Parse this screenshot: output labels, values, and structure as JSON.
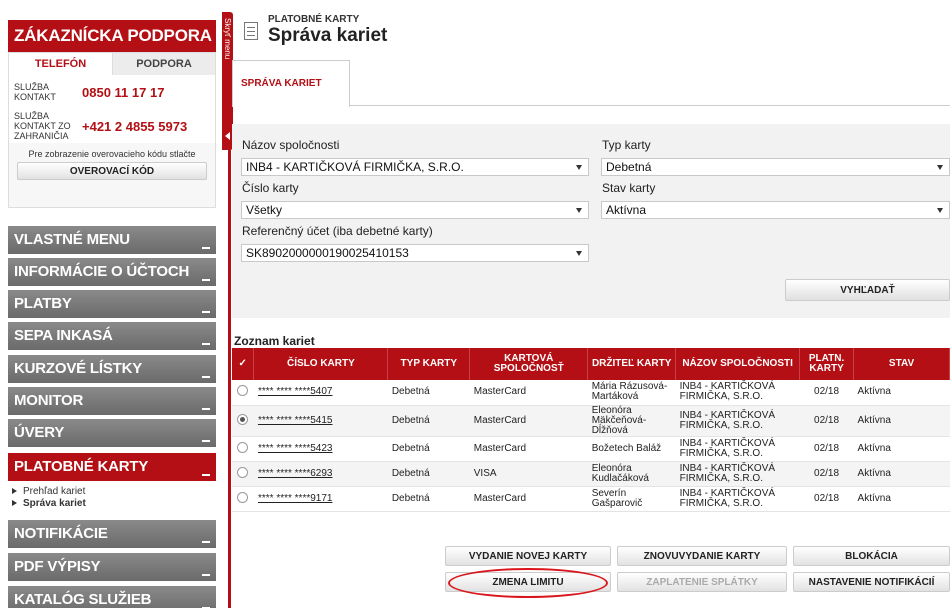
{
  "sidebar": {
    "support_title": "ZÁKAZNÍCKA PODPORA",
    "tab_phone": "TELEFÓN",
    "tab_support": "PODPORA",
    "service_contact_label": "SLUŽBA KONTAKT",
    "service_contact_number": "0850 11 17 17",
    "abroad_label": "SLUŽBA KONTAKT ZO ZAHRANIČIA",
    "abroad_number": "+421 2 4855 5973",
    "verify_text": "Pre zobrazenie overovacieho kódu stlačte",
    "verify_button": "OVEROVACÍ KÓD",
    "menu": [
      "VLASTNÉ MENU",
      "INFORMÁCIE O ÚČTOCH",
      "PLATBY",
      "SEPA INKASÁ",
      "KURZOVÉ LÍSTKY",
      "MONITOR",
      "ÚVERY",
      "PLATOBNÉ KARTY",
      "NOTIFIKÁCIE",
      "PDF VÝPISY",
      "KATALÓG SLUŽIEB"
    ],
    "submenu": [
      "Prehľad kariet",
      "Správa kariet"
    ],
    "collapse_label": "Skryť menu"
  },
  "header": {
    "supertitle": "PLATOBNÉ KARTY",
    "title": "Správa kariet",
    "tab": "SPRÁVA KARIET"
  },
  "filter": {
    "company_label": "Názov spoločnosti",
    "company_value": "INB4 - KARTIČKOVÁ FIRMIČKA, S.R.O.",
    "card_type_label": "Typ karty",
    "card_type_value": "Debetná",
    "card_number_label": "Číslo karty",
    "card_number_value": "Všetky",
    "card_state_label": "Stav karty",
    "card_state_value": "Aktívna",
    "ref_account_label": "Referenčný účet (iba debetné karty)",
    "ref_account_value": "SK8902000000190025410153",
    "search_button": "VYHĽADAŤ"
  },
  "list": {
    "title": "Zoznam kariet",
    "headers": [
      "✓",
      "ČÍSLO KARTY",
      "TYP KARTY",
      "KARTOVÁ SPOLOČNOSŤ",
      "DRŽITEĽ KARTY",
      "NÁZOV SPOLOČNOSTI",
      "PLATN. KARTY",
      "STAV"
    ],
    "rows": [
      {
        "number": "**** **** ****5407",
        "type": "Debetná",
        "company": "MasterCard",
        "holder": "Mária Rázusová-Martáková",
        "org": "INB4 - KARTIČKOVÁ FIRMIČKA, S.R.O.",
        "validity": "02/18",
        "state": "Aktívna"
      },
      {
        "number": "**** **** ****5415",
        "type": "Debetná",
        "company": "MasterCard",
        "holder": "Eleonóra Mäkčeňová-Dĺžňová",
        "org": "INB4 - KARTIČKOVÁ FIRMIČKA, S.R.O.",
        "validity": "02/18",
        "state": "Aktívna"
      },
      {
        "number": "**** **** ****5423",
        "type": "Debetná",
        "company": "MasterCard",
        "holder": "Božetech Baláž",
        "org": "INB4 - KARTIČKOVÁ FIRMIČKA, S.R.O.",
        "validity": "02/18",
        "state": "Aktívna"
      },
      {
        "number": "**** **** ****6293",
        "type": "Debetná",
        "company": "VISA",
        "holder": "Eleonóra Kudlačáková",
        "org": "INB4 - KARTIČKOVÁ FIRMIČKA, S.R.O.",
        "validity": "02/18",
        "state": "Aktívna"
      },
      {
        "number": "**** **** ****9171",
        "type": "Debetná",
        "company": "MasterCard",
        "holder": "Severín Gašparovič",
        "org": "INB4 - KARTIČKOVÁ FIRMIČKA, S.R.O.",
        "validity": "02/18",
        "state": "Aktívna"
      }
    ],
    "selected_row": 1
  },
  "actions": {
    "new_card": "VYDANIE NOVEJ KARTY",
    "reissue": "ZNOVUVYDANIE KARTY",
    "block": "BLOKÁCIA",
    "limit_change": "ZMENA LIMITU",
    "installment": "ZAPLATENIE SPLÁTKY",
    "notification_settings": "NASTAVENIE NOTIFIKÁCIÍ"
  },
  "colors": {
    "brand_red": "#b30f14",
    "menu_gray": "#777777",
    "highlight": "#d9161c"
  }
}
